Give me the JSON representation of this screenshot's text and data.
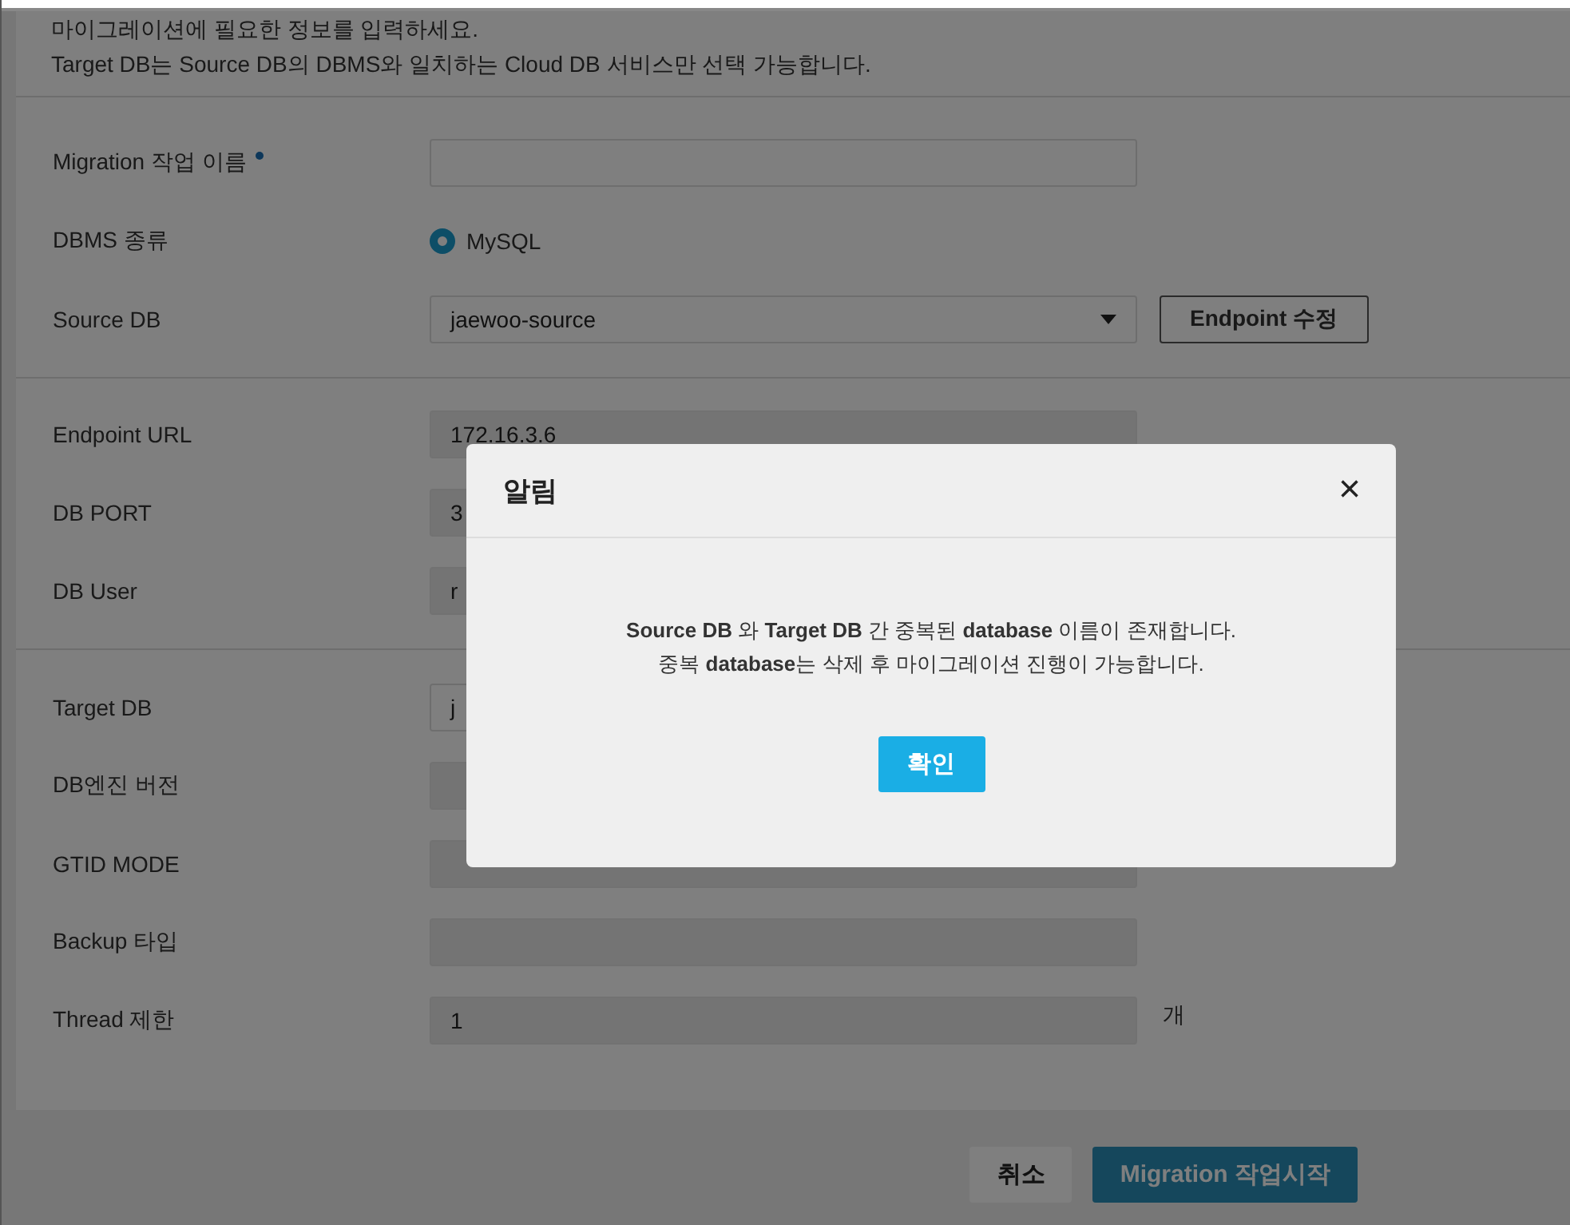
{
  "intro": [
    "마이그레이션에 필요한 정보를 입력하세요.",
    "Target DB는 Source DB의 DBMS와 일치하는 Cloud DB 서비스만 선택 가능합니다."
  ],
  "sections": [
    {
      "rows": [
        {
          "kind": "input",
          "label": "Migration 작업 이름",
          "required": true,
          "value": ""
        },
        {
          "kind": "radio",
          "label": "DBMS 종류",
          "required": false,
          "options": [
            {
              "label": "MySQL",
              "selected": true
            }
          ]
        },
        {
          "kind": "select",
          "label": "Source DB",
          "required": false,
          "value": "jaewoo-source",
          "button": "Endpoint 수정"
        }
      ]
    },
    {
      "rows": [
        {
          "kind": "readonly",
          "label": "Endpoint URL",
          "required": false,
          "value": "172.16.3.6"
        },
        {
          "kind": "readonly",
          "label": "DB PORT",
          "required": false,
          "value": "3"
        },
        {
          "kind": "readonly",
          "label": "DB User",
          "required": false,
          "value": "r"
        }
      ]
    },
    {
      "rows": [
        {
          "kind": "input",
          "label": "Target DB",
          "required": false,
          "value": "j"
        },
        {
          "kind": "readonly",
          "label": "DB엔진 버전",
          "required": false,
          "value": ""
        },
        {
          "kind": "readonly",
          "label": "GTID MODE",
          "required": false,
          "value": ""
        },
        {
          "kind": "readonly",
          "label": "Backup 타입",
          "required": false,
          "value": ""
        },
        {
          "kind": "readonly",
          "label": "Thread 제한",
          "required": false,
          "value": "1",
          "unit": "개"
        }
      ]
    }
  ],
  "footer": [
    {
      "label": "취소",
      "kind": "secondary",
      "disabled": false
    },
    {
      "label": "Migration 작업시작",
      "kind": "primary",
      "disabled": true
    }
  ],
  "dialog": {
    "title": "알림",
    "close": "×",
    "message": [
      "**Source DB** 와 **Target DB** 간 중복된 **database** 이름이 존재합니다.",
      "중복 **database**는 삭제 후 마이그레이션 진행이 가능합니다."
    ],
    "confirm": "확인"
  }
}
